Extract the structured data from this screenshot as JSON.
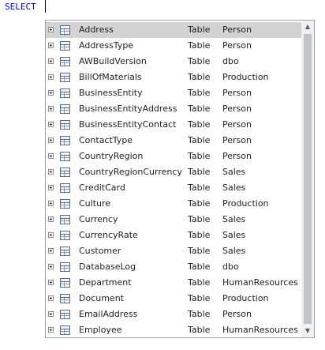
{
  "editor": {
    "text": "SELECT"
  },
  "list": {
    "rows": [
      {
        "name": "Address",
        "type": "Table",
        "schema": "Person"
      },
      {
        "name": "AddressType",
        "type": "Table",
        "schema": "Person"
      },
      {
        "name": "AWBuildVersion",
        "type": "Table",
        "schema": "dbo"
      },
      {
        "name": "BillOfMaterials",
        "type": "Table",
        "schema": "Production"
      },
      {
        "name": "BusinessEntity",
        "type": "Table",
        "schema": "Person"
      },
      {
        "name": "BusinessEntityAddress",
        "type": "Table",
        "schema": "Person"
      },
      {
        "name": "BusinessEntityContact",
        "type": "Table",
        "schema": "Person"
      },
      {
        "name": "ContactType",
        "type": "Table",
        "schema": "Person"
      },
      {
        "name": "CountryRegion",
        "type": "Table",
        "schema": "Person"
      },
      {
        "name": "CountryRegionCurrency",
        "type": "Table",
        "schema": "Sales"
      },
      {
        "name": "CreditCard",
        "type": "Table",
        "schema": "Sales"
      },
      {
        "name": "Culture",
        "type": "Table",
        "schema": "Production"
      },
      {
        "name": "Currency",
        "type": "Table",
        "schema": "Sales"
      },
      {
        "name": "CurrencyRate",
        "type": "Table",
        "schema": "Sales"
      },
      {
        "name": "Customer",
        "type": "Table",
        "schema": "Sales"
      },
      {
        "name": "DatabaseLog",
        "type": "Table",
        "schema": "dbo"
      },
      {
        "name": "Department",
        "type": "Table",
        "schema": "HumanResources"
      },
      {
        "name": "Document",
        "type": "Table",
        "schema": "Production"
      },
      {
        "name": "EmailAddress",
        "type": "Table",
        "schema": "Person"
      },
      {
        "name": "Employee",
        "type": "Table",
        "schema": "HumanResources"
      }
    ],
    "selected_index": 0
  },
  "icons": {
    "expander": "expand-plus-icon",
    "row_icon": "table-icon",
    "scroll_up": "scroll-up-arrow-icon",
    "scroll_down": "scroll-down-arrow-icon"
  },
  "colors": {
    "keyword": "#0000ff",
    "selection": "#d3d3d3",
    "scroll_thumb": "#c2c3c9"
  }
}
